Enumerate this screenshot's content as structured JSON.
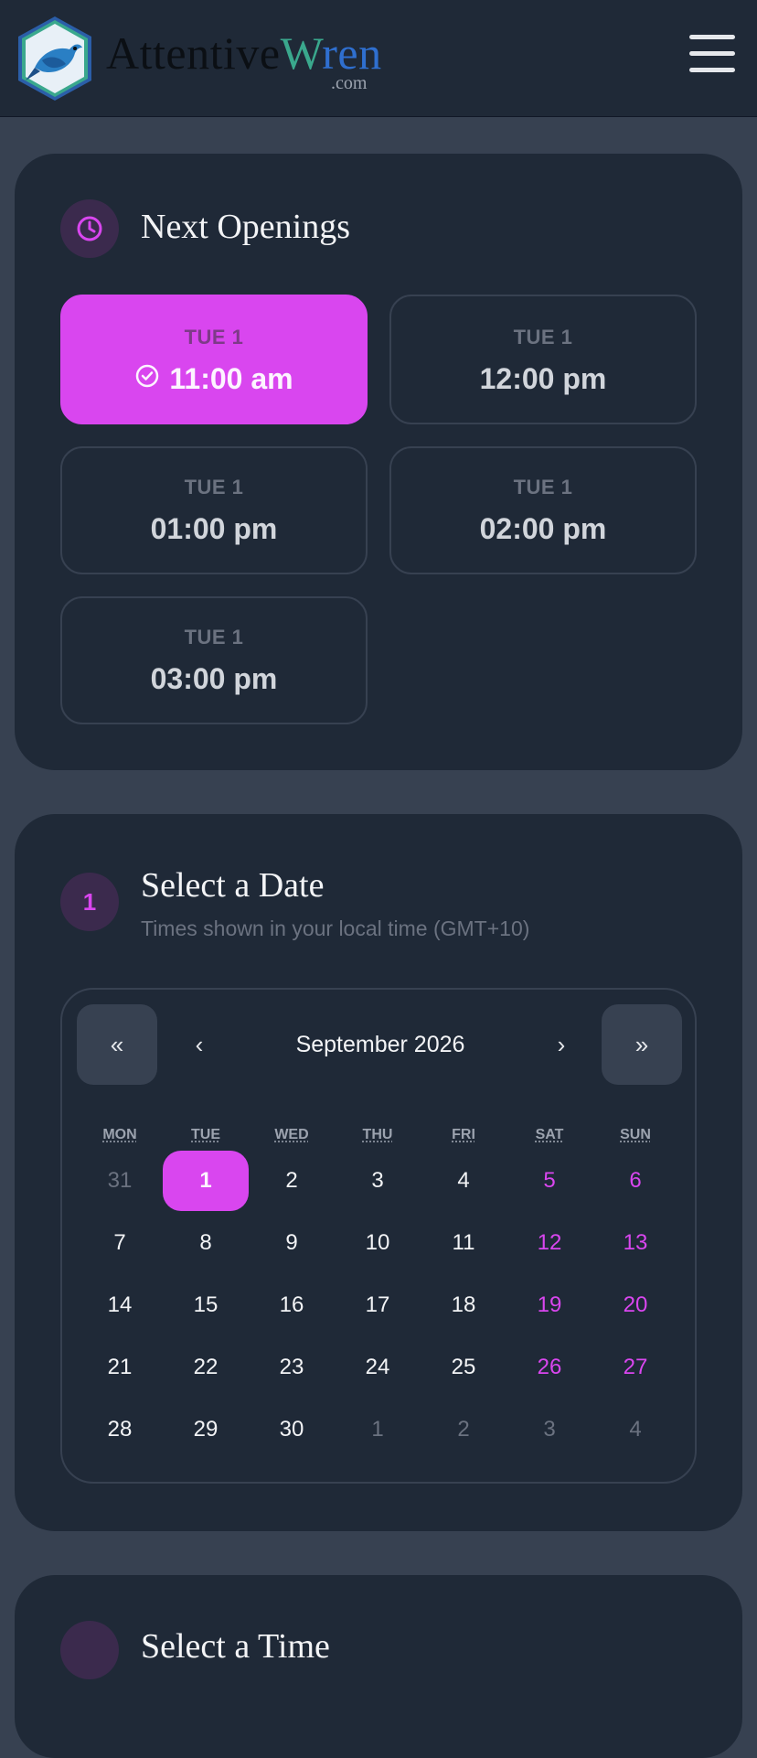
{
  "header": {
    "brand_part1": "Attentive",
    "brand_part2_first": "W",
    "brand_part2_rest": "ren",
    "brand_tld": ".com"
  },
  "openings": {
    "title": "Next Openings",
    "slots": [
      {
        "day": "TUE 1",
        "time": "11:00 am",
        "selected": true
      },
      {
        "day": "TUE 1",
        "time": "12:00 pm",
        "selected": false
      },
      {
        "day": "TUE 1",
        "time": "01:00 pm",
        "selected": false
      },
      {
        "day": "TUE 1",
        "time": "02:00 pm",
        "selected": false
      },
      {
        "day": "TUE 1",
        "time": "03:00 pm",
        "selected": false
      }
    ]
  },
  "date_step": {
    "number": "1",
    "title": "Select a Date",
    "subtitle": "Times shown in your local time (GMT+10)"
  },
  "calendar": {
    "prev_year": "«",
    "prev_month": "‹",
    "month_label": "September 2026",
    "next_month": "›",
    "next_year": "»",
    "weekdays": [
      "MON",
      "TUE",
      "WED",
      "THU",
      "FRI",
      "SAT",
      "SUN"
    ],
    "weeks": [
      [
        "31",
        "1",
        "2",
        "3",
        "4",
        "5",
        "6"
      ],
      [
        "7",
        "8",
        "9",
        "10",
        "11",
        "12",
        "13"
      ],
      [
        "14",
        "15",
        "16",
        "17",
        "18",
        "19",
        "20"
      ],
      [
        "21",
        "22",
        "23",
        "24",
        "25",
        "26",
        "27"
      ],
      [
        "28",
        "29",
        "30",
        "1",
        "2",
        "3",
        "4"
      ]
    ],
    "selected": "1"
  },
  "time_step": {
    "title": "Select a Time"
  },
  "colors": {
    "accent": "#d946ef",
    "card": "#1f2937",
    "background": "#374151"
  }
}
